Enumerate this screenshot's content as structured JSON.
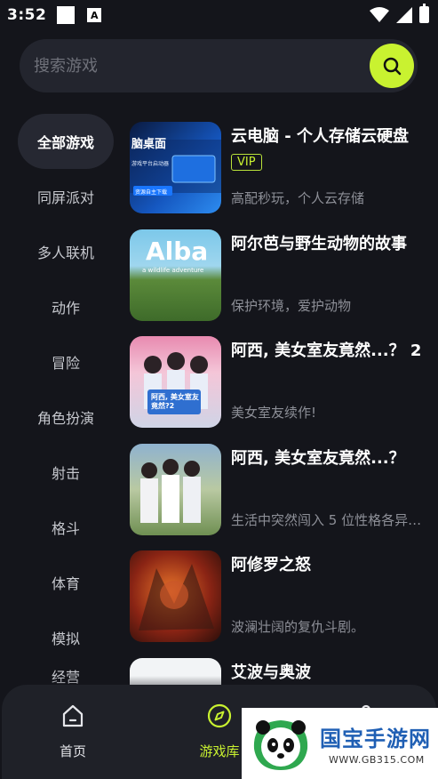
{
  "status_bar": {
    "time": "3:52",
    "a_glyph": "A"
  },
  "search": {
    "placeholder": "搜索游戏"
  },
  "sidebar": {
    "categories": [
      "全部游戏",
      "同屏派对",
      "多人联机",
      "动作",
      "冒险",
      "角色扮演",
      "射击",
      "格斗",
      "体育",
      "模拟",
      "经营"
    ]
  },
  "games": [
    {
      "title": "云电脑 - 个人存储云硬盘",
      "badge": "VIP",
      "desc": "高配秒玩，个人云存储",
      "thumb_text": "脑桌面",
      "thumb_sub": "游戏平台启动器",
      "thumb_tag": "资源自主下载"
    },
    {
      "title": "阿尔芭与野生动物的故事",
      "desc": "保护环境，爱护动物",
      "thumb_text": "Alba",
      "thumb_sub": "a wildlife adventure"
    },
    {
      "title": "阿西, 美女室友竟然...？ 2",
      "desc": "美女室友续作!",
      "thumb_text": "阿西, 美女室友竟然?2"
    },
    {
      "title": "阿西, 美女室友竟然...？",
      "desc": "生活中突然闯入 5 位性格各异的美女室友"
    },
    {
      "title": "阿修罗之怒",
      "desc": "波澜壮阔的复仇斗剧。"
    },
    {
      "title": "艾波与奥波",
      "desc": ""
    }
  ],
  "bottom_nav": {
    "home": "首页",
    "library": "游戏库"
  },
  "watermark": {
    "title": "国宝手游网",
    "url": "WWW.GB315.COM"
  },
  "colors": {
    "accent": "#c9f230",
    "background": "#14151b",
    "surface": "#23252e"
  }
}
